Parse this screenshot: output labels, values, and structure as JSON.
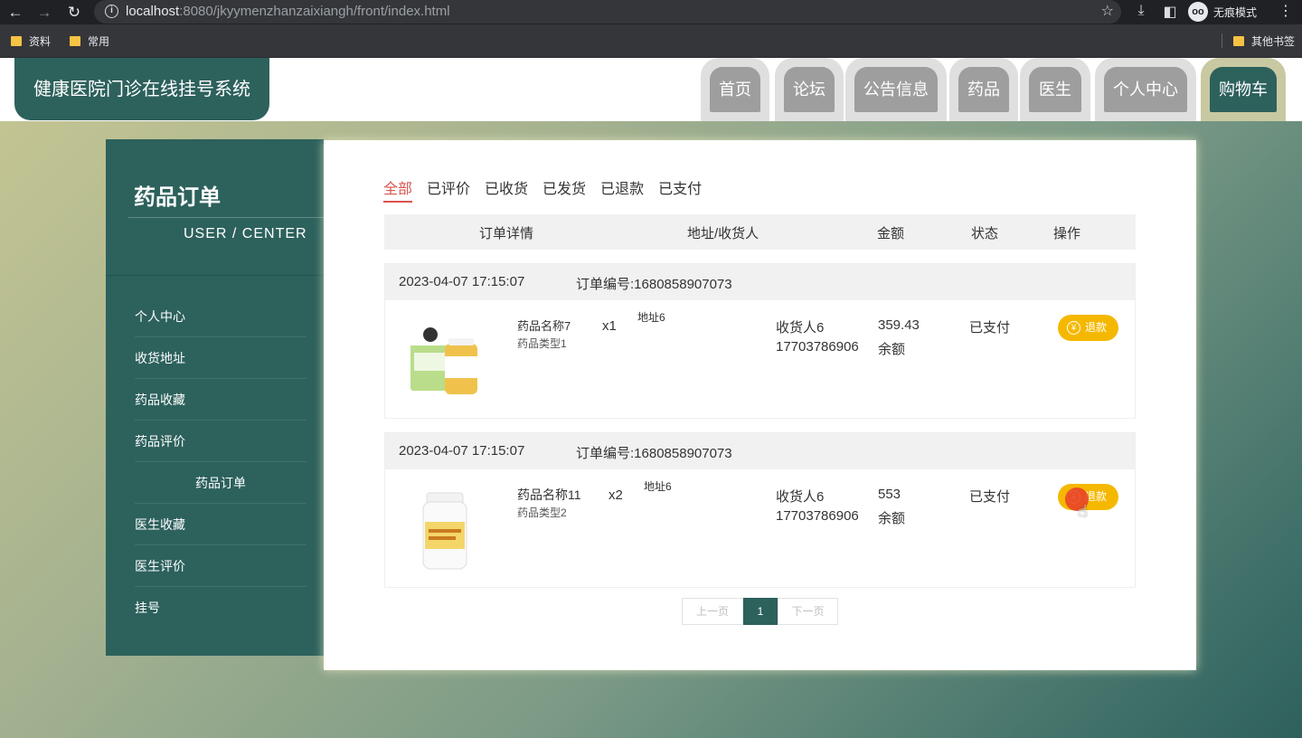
{
  "browser": {
    "url_host": "localhost",
    "url_path": ":8080/jkyymenzhanzaixiangh/front/index.html",
    "incognito_label": "无痕模式",
    "bookmarks": [
      "资料",
      "常用"
    ],
    "other_bookmarks": "其他书签"
  },
  "site": {
    "title": "健康医院门诊在线挂号系统",
    "nav": [
      "首页",
      "论坛",
      "公告信息",
      "药品",
      "医生",
      "个人中心",
      "购物车"
    ]
  },
  "sidebar": {
    "title": "药品订单",
    "subtitle": "USER / CENTER",
    "items": [
      "个人中心",
      "收货地址",
      "药品收藏",
      "药品评价",
      "药品订单",
      "医生收藏",
      "医生评价",
      "挂号"
    ]
  },
  "tabs": [
    "全部",
    "已评价",
    "已收货",
    "已发货",
    "已退款",
    "已支付"
  ],
  "table_header": {
    "detail": "订单详情",
    "address": "地址/收货人",
    "amount": "金额",
    "status": "状态",
    "action": "操作"
  },
  "orders": [
    {
      "time": "2023-04-07 17:15:07",
      "order_no": "订单编号:1680858907073",
      "product_name": "药品名称7",
      "product_type": "药品类型1",
      "qty": "x1",
      "address": "地址6",
      "receiver": "收货人6",
      "phone": "17703786906",
      "amount": "359.43",
      "pay_method": "余额",
      "status": "已支付",
      "action": "退款"
    },
    {
      "time": "2023-04-07 17:15:07",
      "order_no": "订单编号:1680858907073",
      "product_name": "药品名称11",
      "product_type": "药品类型2",
      "qty": "x2",
      "address": "地址6",
      "receiver": "收货人6",
      "phone": "17703786906",
      "amount": "553",
      "pay_method": "余额",
      "status": "已支付",
      "action": "退款"
    }
  ],
  "pager": {
    "prev": "上一页",
    "current": "1",
    "next": "下一页"
  }
}
